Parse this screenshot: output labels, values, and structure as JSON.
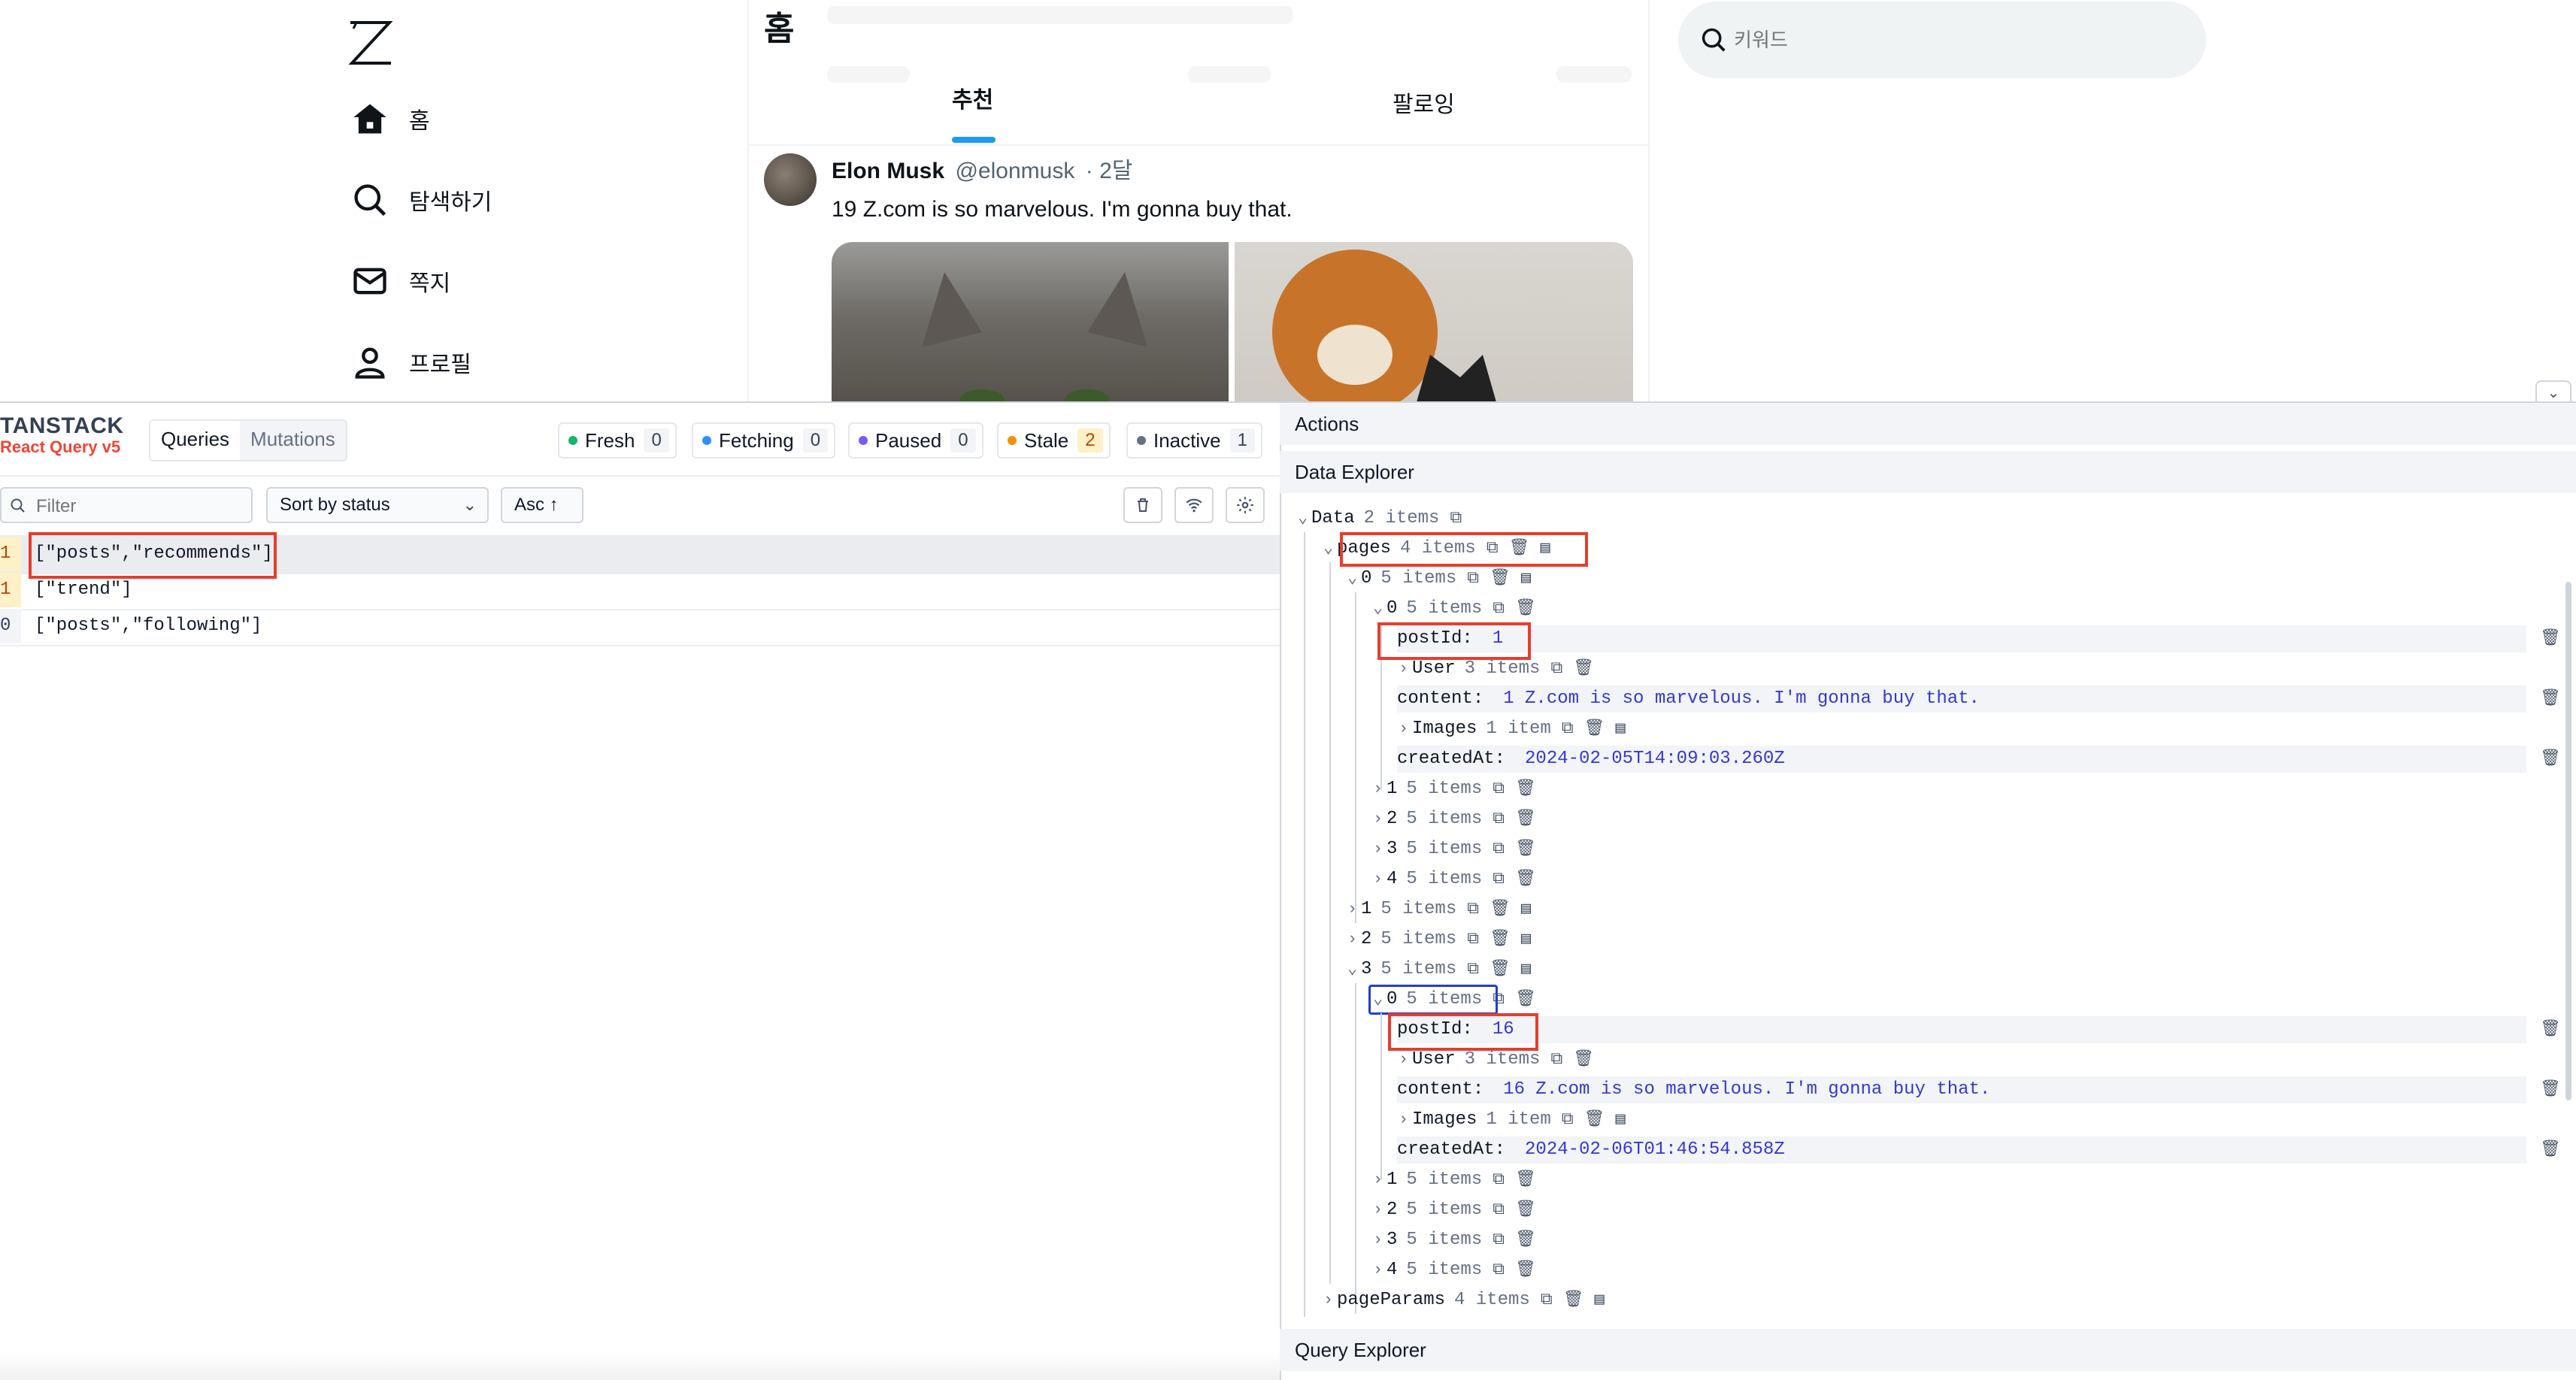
{
  "app": {
    "page_title": "홈",
    "nav": [
      {
        "label": "홈",
        "icon": "home-icon"
      },
      {
        "label": "탐색하기",
        "icon": "search-icon"
      },
      {
        "label": "쪽지",
        "icon": "mail-icon"
      },
      {
        "label": "프로필",
        "icon": "profile-icon"
      }
    ],
    "tabs": {
      "recommend": "추천",
      "following": "팔로잉"
    },
    "search": {
      "placeholder": "키워드"
    },
    "tweet": {
      "name": "Elon Musk",
      "handle": "@elonmusk",
      "time": "· 2달",
      "content": "19 Z.com is so marvelous. I'm gonna buy that."
    }
  },
  "devtools": {
    "brand": {
      "line1": "TANSTACK",
      "line2": "React Query v5"
    },
    "tabs": {
      "queries": "Queries",
      "mutations": "Mutations"
    },
    "statuses": [
      {
        "label": "Fresh",
        "count": "0",
        "color": "#12b76a"
      },
      {
        "label": "Fetching",
        "count": "0",
        "color": "#2e90fa"
      },
      {
        "label": "Paused",
        "count": "0",
        "color": "#7a5af8"
      },
      {
        "label": "Stale",
        "count": "2",
        "color": "#f79009"
      },
      {
        "label": "Inactive",
        "count": "1",
        "color": "#667085"
      }
    ],
    "filter_placeholder": "Filter",
    "sort_label": "Sort by status",
    "order_label": "Asc ↑",
    "queries": [
      {
        "count": "1",
        "key": "[\"posts\",\"recommends\"]"
      },
      {
        "count": "1",
        "key": "[\"trend\"]"
      },
      {
        "count": "0",
        "key": "[\"posts\",\"following\"]"
      }
    ],
    "actions_label": "Actions",
    "data_explorer_label": "Data Explorer",
    "query_explorer_label": "Query Explorer",
    "tree": {
      "data": {
        "key": "Data",
        "count": "2 items"
      },
      "pages": {
        "key": "pages",
        "count": "4 items"
      },
      "page0": {
        "key": "0",
        "count": "5 items"
      },
      "page0_item0": {
        "key": "0",
        "count": "5 items"
      },
      "post1": {
        "postId_label": "postId:",
        "postId": "1",
        "user_label": "User",
        "user_count": "3 items",
        "content_label": "content:",
        "content": "1 Z.com is so marvelous. I'm gonna buy that.",
        "images_label": "Images",
        "images_count": "1 item",
        "createdAt_label": "createdAt:",
        "createdAt": "2024-02-05T14:09:03.260Z"
      },
      "page0_rest": [
        {
          "key": "1",
          "count": "5 items"
        },
        {
          "key": "2",
          "count": "5 items"
        },
        {
          "key": "3",
          "count": "5 items"
        },
        {
          "key": "4",
          "count": "5 items"
        }
      ],
      "pages_mid": [
        {
          "key": "1",
          "count": "5 items"
        },
        {
          "key": "2",
          "count": "5 items"
        }
      ],
      "page3": {
        "key": "3",
        "count": "5 items"
      },
      "page3_item0": {
        "key": "0",
        "count": "5 items"
      },
      "post16": {
        "postId_label": "postId:",
        "postId": "16",
        "user_label": "User",
        "user_count": "3 items",
        "content_label": "content:",
        "content": "16 Z.com is so marvelous. I'm gonna buy that.",
        "images_label": "Images",
        "images_count": "1 item",
        "createdAt_label": "createdAt:",
        "createdAt": "2024-02-06T01:46:54.858Z"
      },
      "page3_rest": [
        {
          "key": "1",
          "count": "5 items"
        },
        {
          "key": "2",
          "count": "5 items"
        },
        {
          "key": "3",
          "count": "5 items"
        },
        {
          "key": "4",
          "count": "5 items"
        }
      ],
      "pageParams": {
        "key": "pageParams",
        "count": "4 items"
      }
    }
  }
}
